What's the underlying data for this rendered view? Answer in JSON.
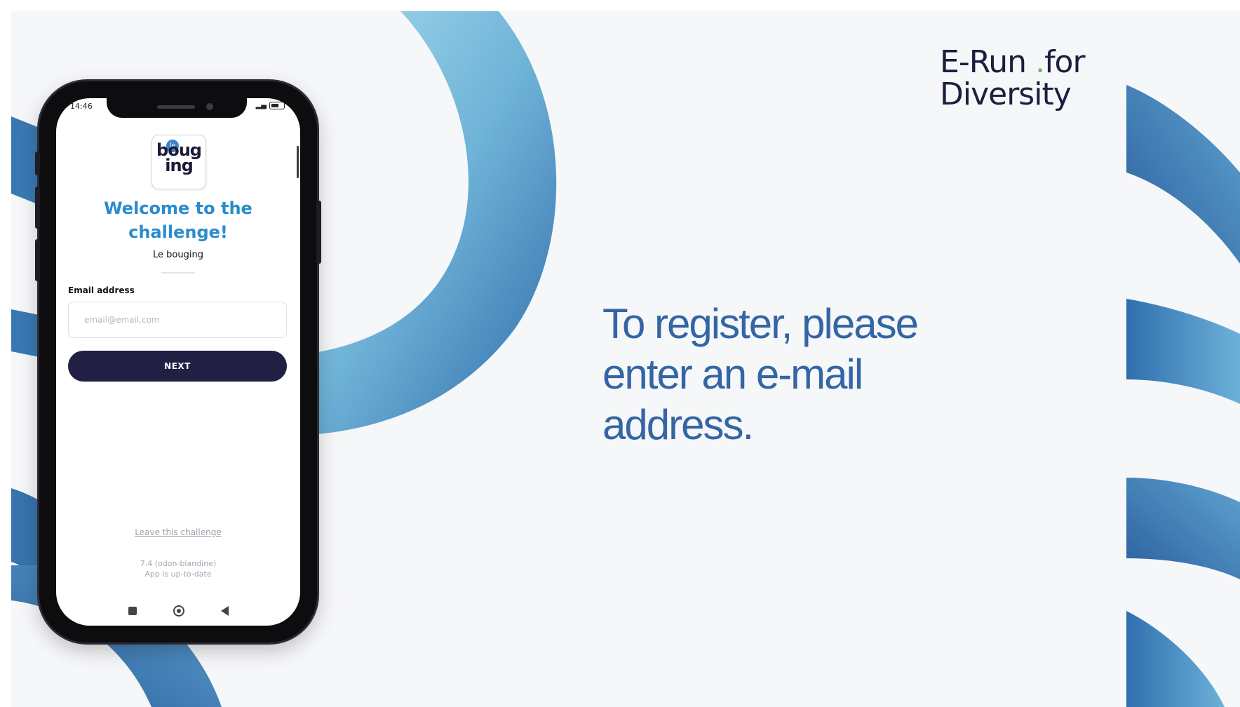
{
  "phone": {
    "status_time": "14:46",
    "status_icons": "signal wifi battery",
    "app_logo_text": "boug ing",
    "app_logo_badge": "le",
    "welcome_title": "Welcome to the challenge!",
    "organization": "Le bouging",
    "email_label": "Email address",
    "email_placeholder": "email@email.com",
    "email_value": "",
    "next_label": "NEXT",
    "leave_link": "Leave this challenge",
    "version_line": "7.4 (odon-blandine)",
    "update_status": "App is up-to-date",
    "nav_icons": [
      "recents-icon",
      "home-icon",
      "back-icon"
    ]
  },
  "brand": {
    "line1_a": "E",
    "line1_b": "-",
    "line1_c": "Run ",
    "line1_dot": ".",
    "line1_d": "for",
    "line2": "Diversity"
  },
  "headline": "To register, please enter an e-mail address.",
  "colors": {
    "accent_blue": "#3465a4",
    "welcome_blue": "#2a8ccc",
    "button_navy": "#221f44",
    "ribbon_light": "#8ccbe3",
    "ribbon_dark": "#2e6aa6"
  }
}
